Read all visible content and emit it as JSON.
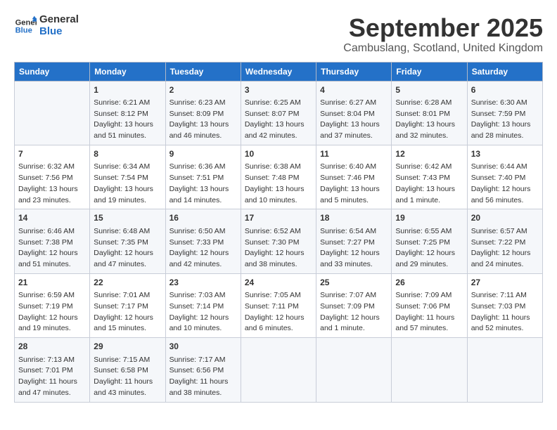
{
  "header": {
    "logo_line1": "General",
    "logo_line2": "Blue",
    "title": "September 2025",
    "subtitle": "Cambuslang, Scotland, United Kingdom"
  },
  "weekdays": [
    "Sunday",
    "Monday",
    "Tuesday",
    "Wednesday",
    "Thursday",
    "Friday",
    "Saturday"
  ],
  "weeks": [
    [
      {
        "day": "",
        "info": ""
      },
      {
        "day": "1",
        "info": "Sunrise: 6:21 AM\nSunset: 8:12 PM\nDaylight: 13 hours\nand 51 minutes."
      },
      {
        "day": "2",
        "info": "Sunrise: 6:23 AM\nSunset: 8:09 PM\nDaylight: 13 hours\nand 46 minutes."
      },
      {
        "day": "3",
        "info": "Sunrise: 6:25 AM\nSunset: 8:07 PM\nDaylight: 13 hours\nand 42 minutes."
      },
      {
        "day": "4",
        "info": "Sunrise: 6:27 AM\nSunset: 8:04 PM\nDaylight: 13 hours\nand 37 minutes."
      },
      {
        "day": "5",
        "info": "Sunrise: 6:28 AM\nSunset: 8:01 PM\nDaylight: 13 hours\nand 32 minutes."
      },
      {
        "day": "6",
        "info": "Sunrise: 6:30 AM\nSunset: 7:59 PM\nDaylight: 13 hours\nand 28 minutes."
      }
    ],
    [
      {
        "day": "7",
        "info": "Sunrise: 6:32 AM\nSunset: 7:56 PM\nDaylight: 13 hours\nand 23 minutes."
      },
      {
        "day": "8",
        "info": "Sunrise: 6:34 AM\nSunset: 7:54 PM\nDaylight: 13 hours\nand 19 minutes."
      },
      {
        "day": "9",
        "info": "Sunrise: 6:36 AM\nSunset: 7:51 PM\nDaylight: 13 hours\nand 14 minutes."
      },
      {
        "day": "10",
        "info": "Sunrise: 6:38 AM\nSunset: 7:48 PM\nDaylight: 13 hours\nand 10 minutes."
      },
      {
        "day": "11",
        "info": "Sunrise: 6:40 AM\nSunset: 7:46 PM\nDaylight: 13 hours\nand 5 minutes."
      },
      {
        "day": "12",
        "info": "Sunrise: 6:42 AM\nSunset: 7:43 PM\nDaylight: 13 hours\nand 1 minute."
      },
      {
        "day": "13",
        "info": "Sunrise: 6:44 AM\nSunset: 7:40 PM\nDaylight: 12 hours\nand 56 minutes."
      }
    ],
    [
      {
        "day": "14",
        "info": "Sunrise: 6:46 AM\nSunset: 7:38 PM\nDaylight: 12 hours\nand 51 minutes."
      },
      {
        "day": "15",
        "info": "Sunrise: 6:48 AM\nSunset: 7:35 PM\nDaylight: 12 hours\nand 47 minutes."
      },
      {
        "day": "16",
        "info": "Sunrise: 6:50 AM\nSunset: 7:33 PM\nDaylight: 12 hours\nand 42 minutes."
      },
      {
        "day": "17",
        "info": "Sunrise: 6:52 AM\nSunset: 7:30 PM\nDaylight: 12 hours\nand 38 minutes."
      },
      {
        "day": "18",
        "info": "Sunrise: 6:54 AM\nSunset: 7:27 PM\nDaylight: 12 hours\nand 33 minutes."
      },
      {
        "day": "19",
        "info": "Sunrise: 6:55 AM\nSunset: 7:25 PM\nDaylight: 12 hours\nand 29 minutes."
      },
      {
        "day": "20",
        "info": "Sunrise: 6:57 AM\nSunset: 7:22 PM\nDaylight: 12 hours\nand 24 minutes."
      }
    ],
    [
      {
        "day": "21",
        "info": "Sunrise: 6:59 AM\nSunset: 7:19 PM\nDaylight: 12 hours\nand 19 minutes."
      },
      {
        "day": "22",
        "info": "Sunrise: 7:01 AM\nSunset: 7:17 PM\nDaylight: 12 hours\nand 15 minutes."
      },
      {
        "day": "23",
        "info": "Sunrise: 7:03 AM\nSunset: 7:14 PM\nDaylight: 12 hours\nand 10 minutes."
      },
      {
        "day": "24",
        "info": "Sunrise: 7:05 AM\nSunset: 7:11 PM\nDaylight: 12 hours\nand 6 minutes."
      },
      {
        "day": "25",
        "info": "Sunrise: 7:07 AM\nSunset: 7:09 PM\nDaylight: 12 hours\nand 1 minute."
      },
      {
        "day": "26",
        "info": "Sunrise: 7:09 AM\nSunset: 7:06 PM\nDaylight: 11 hours\nand 57 minutes."
      },
      {
        "day": "27",
        "info": "Sunrise: 7:11 AM\nSunset: 7:03 PM\nDaylight: 11 hours\nand 52 minutes."
      }
    ],
    [
      {
        "day": "28",
        "info": "Sunrise: 7:13 AM\nSunset: 7:01 PM\nDaylight: 11 hours\nand 47 minutes."
      },
      {
        "day": "29",
        "info": "Sunrise: 7:15 AM\nSunset: 6:58 PM\nDaylight: 11 hours\nand 43 minutes."
      },
      {
        "day": "30",
        "info": "Sunrise: 7:17 AM\nSunset: 6:56 PM\nDaylight: 11 hours\nand 38 minutes."
      },
      {
        "day": "",
        "info": ""
      },
      {
        "day": "",
        "info": ""
      },
      {
        "day": "",
        "info": ""
      },
      {
        "day": "",
        "info": ""
      }
    ]
  ]
}
